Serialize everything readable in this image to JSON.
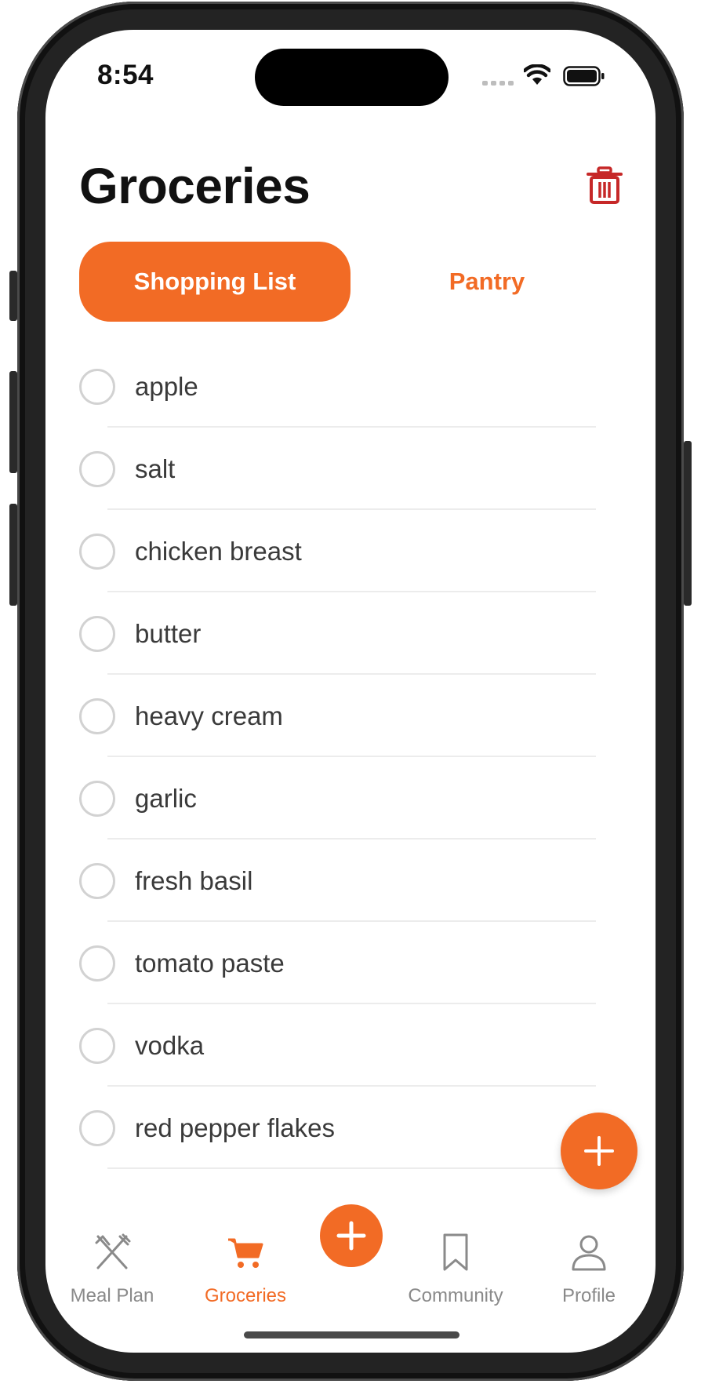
{
  "status_bar": {
    "time": "8:54"
  },
  "header": {
    "title": "Groceries"
  },
  "tabs": [
    {
      "label": "Shopping List",
      "active": true
    },
    {
      "label": "Pantry",
      "active": false
    }
  ],
  "shopping_list": {
    "items": [
      {
        "label": "apple",
        "checked": false
      },
      {
        "label": "salt",
        "checked": false
      },
      {
        "label": "chicken breast",
        "checked": false
      },
      {
        "label": "butter",
        "checked": false
      },
      {
        "label": "heavy cream",
        "checked": false
      },
      {
        "label": "garlic",
        "checked": false
      },
      {
        "label": "fresh basil",
        "checked": false
      },
      {
        "label": "tomato paste",
        "checked": false
      },
      {
        "label": "vodka",
        "checked": false
      },
      {
        "label": "red pepper flakes",
        "checked": false
      }
    ]
  },
  "bottom_nav": {
    "items": [
      {
        "label": "Meal Plan",
        "icon": "fork-knife-icon",
        "active": false
      },
      {
        "label": "Groceries",
        "icon": "cart-icon",
        "active": true
      },
      {
        "label": "Community",
        "icon": "bookmark-icon",
        "active": false
      },
      {
        "label": "Profile",
        "icon": "person-icon",
        "active": false
      }
    ]
  },
  "colors": {
    "accent": "#f26b25",
    "trash": "#c62828",
    "text": "#111111",
    "muted": "#8a8a8a"
  }
}
